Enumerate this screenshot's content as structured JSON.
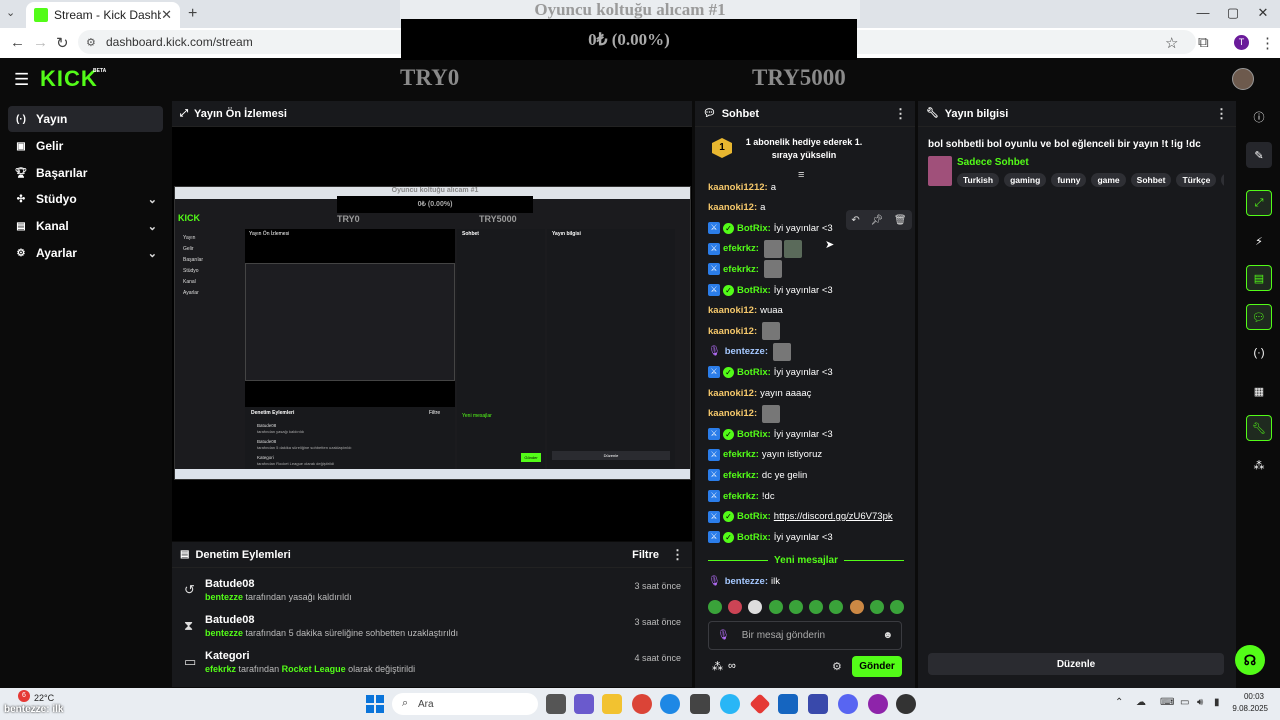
{
  "browser": {
    "tab_title": "Stream - Kick Dashboard",
    "url": "dashboard.kick.com/stream",
    "profile_initial": "T"
  },
  "overlay": {
    "goal_title": "Oyuncu koltuğu alıcam #1",
    "goal_progress_text": "0₺ (0.00%)",
    "goal_progress_fraction": 0,
    "goal_min": "TRY0",
    "goal_max": "TRY5000"
  },
  "app": {
    "logo": "KICK",
    "beta": "BETA"
  },
  "sidebar": {
    "items": [
      {
        "label": "Yayın",
        "icon": "broadcast-icon",
        "active": true,
        "expandable": false
      },
      {
        "label": "Gelir",
        "icon": "revenue-icon",
        "active": false,
        "expandable": false
      },
      {
        "label": "Başarılar",
        "icon": "trophy-icon",
        "active": false,
        "expandable": false
      },
      {
        "label": "Stüdyo",
        "icon": "studio-icon",
        "active": false,
        "expandable": true
      },
      {
        "label": "Kanal",
        "icon": "channel-icon",
        "active": false,
        "expandable": true
      },
      {
        "label": "Ayarlar",
        "icon": "gear-icon",
        "active": false,
        "expandable": true
      }
    ]
  },
  "preview": {
    "title": "Yayın Ön İzlemesi",
    "nested": {
      "goal_title": "Oyuncu koltuğu alıcam #1",
      "goal_progress_text": "0₺ (0.00%)",
      "goal_min": "TRY0",
      "goal_max": "TRY5000",
      "logo": "KICK",
      "preview_title": "Yayın Ön İzlemesi",
      "chat_title": "Sohbet",
      "info_title": "Yayın bilgisi",
      "mod_title": "Denetim Eylemleri",
      "filter": "Filtre",
      "sidebar": [
        "Yayın",
        "Gelir",
        "Başarılar",
        "Stüdyo",
        "Kanal",
        "Ayarlar"
      ],
      "mod_rows": [
        {
          "title": "Batude08",
          "sub": "tarafından yasağı kaldırıldı"
        },
        {
          "title": "Batude08",
          "sub": "tarafından 5 dakika süreliğine sohbetten uzaklaştırıldı"
        },
        {
          "title": "Kategori",
          "sub": "tarafından Rocket League olarak değiştirildi"
        }
      ],
      "edit": "Düzenle",
      "send": "Gönder",
      "new_messages": "Yeni mesajlar"
    }
  },
  "moderation": {
    "title": "Denetim Eylemleri",
    "filter_label": "Filtre",
    "rows": [
      {
        "icon": "unban-icon",
        "title": "Batude08",
        "user": "bentezze",
        "text": "tarafından yasağı kaldırıldı",
        "time": "3 saat önce"
      },
      {
        "icon": "hourglass-icon",
        "title": "Batude08",
        "user": "bentezze",
        "text": "tarafından 5 dakika süreliğine sohbetten uzaklaştırıldı",
        "time": "3 saat önce"
      },
      {
        "icon": "category-icon",
        "title": "Kategori",
        "user": "efekrkz",
        "text": "tarafından",
        "highlight": "Rocket League",
        "text2": "olarak değiştirildi",
        "time": "4 saat önce"
      }
    ]
  },
  "chat": {
    "title": "Sohbet",
    "goal_rank": "1",
    "goal_text": "1 abonelik hediye ederek 1. sıraya yükselin",
    "messages": [
      {
        "user": "kaanoki1212",
        "color": "#f5c86b",
        "text": "a",
        "badge": false,
        "verified": false,
        "mic": false,
        "emotes": 0
      },
      {
        "user": "kaanoki12",
        "color": "#f5c86b",
        "text": "a",
        "badge": false,
        "verified": false,
        "mic": false,
        "emotes": 0
      },
      {
        "user": "BotRix",
        "color": "#53fc18",
        "text": "İyi yayınlar <3",
        "badge": true,
        "verified": true,
        "mic": false,
        "emotes": 0
      },
      {
        "user": "efekrkz",
        "color": "#53fc18",
        "text": "",
        "badge": true,
        "verified": false,
        "mic": false,
        "emotes": 2
      },
      {
        "user": "efekrkz",
        "color": "#53fc18",
        "text": "",
        "badge": true,
        "verified": false,
        "mic": false,
        "emotes": 1
      },
      {
        "user": "BotRix",
        "color": "#53fc18",
        "text": "İyi yayınlar <3",
        "badge": true,
        "verified": true,
        "mic": false,
        "emotes": 0
      },
      {
        "user": "kaanoki12",
        "color": "#f5c86b",
        "text": "wuaa",
        "badge": false,
        "verified": false,
        "mic": false,
        "emotes": 0
      },
      {
        "user": "kaanoki12",
        "color": "#f5c86b",
        "text": "",
        "badge": false,
        "verified": false,
        "mic": false,
        "emotes": 1
      },
      {
        "user": "bentezze",
        "color": "#a5c8ff",
        "text": "",
        "badge": false,
        "verified": false,
        "mic": true,
        "emotes": 1
      },
      {
        "user": "BotRix",
        "color": "#53fc18",
        "text": "İyi yayınlar <3",
        "badge": true,
        "verified": true,
        "mic": false,
        "emotes": 0
      },
      {
        "user": "kaanoki12",
        "color": "#f5c86b",
        "text": "yayın aaaaç",
        "badge": false,
        "verified": false,
        "mic": false,
        "emotes": 0
      },
      {
        "user": "kaanoki12",
        "color": "#f5c86b",
        "text": "",
        "badge": false,
        "verified": false,
        "mic": false,
        "emotes": 1
      },
      {
        "user": "BotRix",
        "color": "#53fc18",
        "text": "İyi yayınlar <3",
        "badge": true,
        "verified": true,
        "mic": false,
        "emotes": 0
      },
      {
        "user": "efekrkz",
        "color": "#53fc18",
        "text": "yayın istiyoruz",
        "badge": true,
        "verified": false,
        "mic": false,
        "emotes": 0
      },
      {
        "user": "efekrkz",
        "color": "#53fc18",
        "text": "dc ye gelin",
        "badge": true,
        "verified": false,
        "mic": false,
        "emotes": 0
      },
      {
        "user": "efekrkz",
        "color": "#53fc18",
        "text": "!dc",
        "badge": true,
        "verified": false,
        "mic": false,
        "emotes": 0
      },
      {
        "user": "BotRix",
        "color": "#53fc18",
        "text": "https://discord.gg/zU6V73pk",
        "badge": true,
        "verified": true,
        "mic": false,
        "emotes": 0,
        "link": true
      },
      {
        "user": "BotRix",
        "color": "#53fc18",
        "text": "İyi yayınlar <3",
        "badge": true,
        "verified": true,
        "mic": false,
        "emotes": 0
      }
    ],
    "new_messages_label": "Yeni mesajlar",
    "after_messages": [
      {
        "user": "bentezze",
        "color": "#a5c8ff",
        "text": "ilk",
        "mic": true
      }
    ],
    "input_placeholder": "Bir mesaj gönderin",
    "send_label": "Gönder"
  },
  "info": {
    "title": "Yayın bilgisi",
    "stream_title": "bol sohbetli bol oyunlu ve bol eğlenceli bir yayın !t !ig !dc",
    "category": "Sadece Sohbet",
    "tags": [
      "Turkish",
      "gaming",
      "funny",
      "game",
      "Sohbet",
      "Türkçe",
      "oyu"
    ],
    "edit_label": "Düzenle"
  },
  "taskbar": {
    "weather_temp": "22°C",
    "weather_badge": "6",
    "stream_name": "bentezze",
    "stream_msg": "ilk",
    "search_placeholder": "Ara",
    "time": "00:03",
    "date": "9.08.2025"
  }
}
